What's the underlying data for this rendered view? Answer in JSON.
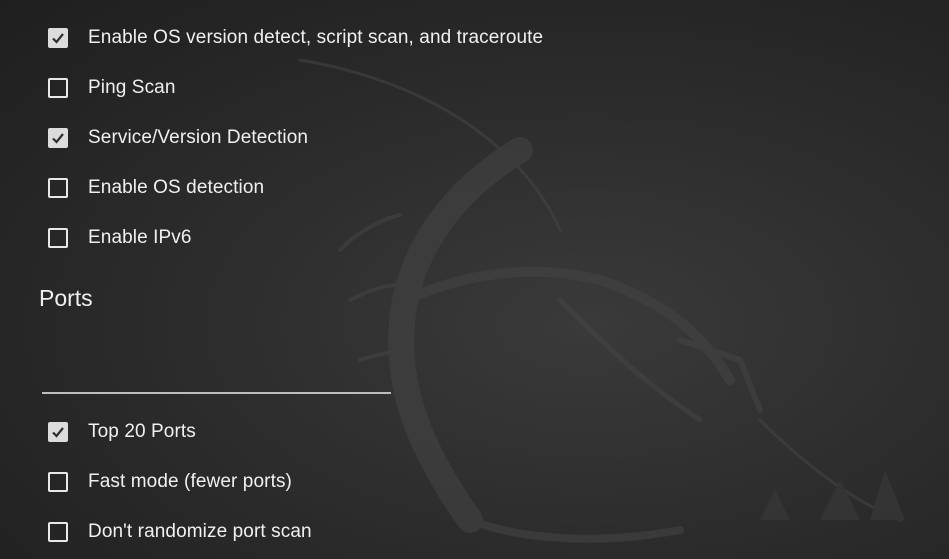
{
  "scan_options": [
    {
      "label": "Enable OS version detect, script scan, and traceroute",
      "checked": true
    },
    {
      "label": "Ping Scan",
      "checked": false
    },
    {
      "label": "Service/Version Detection",
      "checked": true
    },
    {
      "label": "Enable OS detection",
      "checked": false
    },
    {
      "label": "Enable IPv6",
      "checked": false
    }
  ],
  "ports": {
    "title": "Ports",
    "input_value": "",
    "options": [
      {
        "label": "Top 20 Ports",
        "checked": true
      },
      {
        "label": "Fast mode (fewer ports)",
        "checked": false
      },
      {
        "label": "Don't randomize port scan",
        "checked": false
      }
    ]
  },
  "theme": {
    "background": "#2b2b2b",
    "text": "#f0f0f0",
    "checkbox": "#dcdcdc"
  }
}
